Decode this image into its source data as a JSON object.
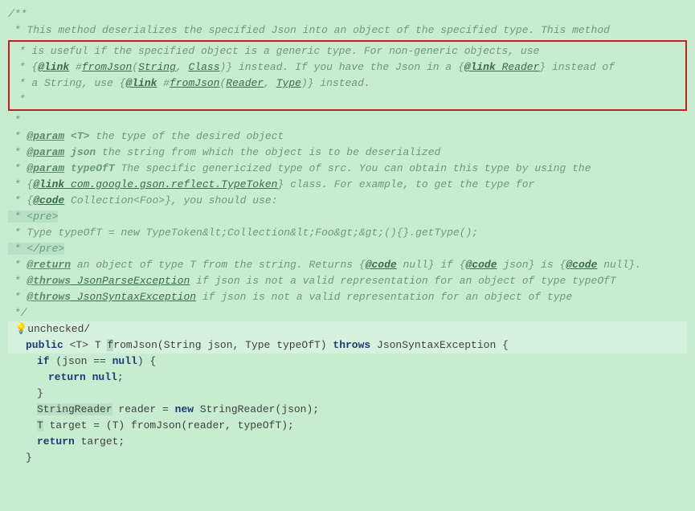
{
  "javadoc": {
    "open": "/**",
    "l1": " * This method deserializes the specified Json into an object of the specified type. This method",
    "box": {
      "l1a": " * is useful if the specified object is a generic type. For non-generic objects, use",
      "l2_pre": " * {",
      "l2_link": "@link",
      "l2_ref": " #",
      "l2_fn": "fromJson",
      "l2_p1": "(",
      "l2_str": "String",
      "l2_c": ", ",
      "l2_cls": "Class",
      "l2_p2": ")}",
      "l2_post": " instead. If you have the Json in a {",
      "l2_link2": "@link",
      "l2_reader": " Reader",
      "l2_end": "} instead of",
      "l3_pre": " * a String, use {",
      "l3_link": "@link",
      "l3_ref": " #",
      "l3_fn": "fromJson",
      "l3_p1": "(",
      "l3_r": "Reader",
      "l3_c": ", ",
      "l3_t": "Type",
      "l3_p2": ")}",
      "l3_post": " instead.",
      "l4": " *"
    },
    "blank": " *",
    "p1_tag": "@param",
    "p1_name": " <T>",
    "p1_desc": " the type of the desired object",
    "p2_tag": "@param",
    "p2_name": " json",
    "p2_desc": " the string from which the object is to be deserialized",
    "p3_tag": "@param",
    "p3_name": " typeOfT",
    "p3_desc": " The specific genericized type of src. You can obtain this type by using the",
    "p4_pre": " * {",
    "p4_link": "@link",
    "p4_ref": " com.google.gson.reflect.TypeToken",
    "p4_post": "} class. For example, to get the type for",
    "p5_pre": " * {",
    "p5_code": "@code",
    "p5_ref": " Collection<Foo>",
    "p5_post": "}, you should use:",
    "pre_open": " * <pre>",
    "pre_body": " * Type typeOfT = new TypeToken&lt;Collection&lt;Foo&gt;&gt;(){}.getType();",
    "pre_close": " * </pre>",
    "ret_tag": "@return",
    "ret_desc": " an object of type T from the string. Returns {",
    "ret_code1": "@code",
    "ret_null": " null",
    "ret_mid": "} if {",
    "ret_code2": "@code",
    "ret_json": " json",
    "ret_mid2": "} is {",
    "ret_code3": "@code",
    "ret_null2": " null",
    "ret_end": "}.",
    "th1_tag": "@throws",
    "th1_ex": " JsonParseException",
    "th1_desc": " if json is not a valid representation for an object of type typeOfT",
    "th2_tag": "@throws",
    "th2_ex": " JsonSyntaxException",
    "th2_desc": " if json is not a valid representation for an object of type",
    "close": " */"
  },
  "unchecked": "unchecked/",
  "code": {
    "public": "public",
    "tparam": "<T>",
    "rettype": "T",
    "fname_f": "f",
    "fname_rest": "romJson",
    "arg1_type": "String",
    "arg1_name": "json",
    "arg2_type": "Type",
    "arg2_name": "typeOfT",
    "throws_kw": "throws",
    "throws_ex": "JsonSyntaxException",
    "if_kw": "if",
    "if_cond": " (json == ",
    "null_kw": "null",
    "if_close": ") {",
    "return_kw": "return",
    "ret_null": "null",
    "semi": ";",
    "brace_close": "}",
    "sr_type": "StringReader",
    "sr_var": " reader = ",
    "new_kw": "new",
    "sr_ctor": " StringReader(json);",
    "t_type": "T",
    "t_line": " target = (T) fromJson(reader, typeOfT);",
    "ret2": "return",
    "ret2_val": " target;"
  }
}
